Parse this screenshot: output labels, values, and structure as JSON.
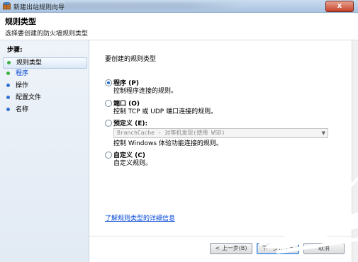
{
  "window": {
    "title": "新建出站规则向导",
    "close_glyph": "x"
  },
  "header": {
    "title": "规则类型",
    "subtitle": "选择要创建的防火墙规则类型"
  },
  "nav": {
    "heading": "步骤:",
    "items": [
      {
        "label": "规则类型",
        "dot_color": "#3cb043",
        "selected": true
      },
      {
        "label": "程序",
        "dot_color": "#3cb043",
        "selected": false
      },
      {
        "label": "操作",
        "dot_color": "#2f6fd0",
        "selected": false
      },
      {
        "label": "配置文件",
        "dot_color": "#2f6fd0",
        "selected": false
      },
      {
        "label": "名称",
        "dot_color": "#2f6fd0",
        "selected": false
      }
    ]
  },
  "main": {
    "question": "要创建的规则类型",
    "options": [
      {
        "label": "程序 (P)",
        "description": "控制程序连接的规则。",
        "checked": true
      },
      {
        "label": "端口 (O)",
        "description": "控制 TCP 或 UDP 端口连接的规则。",
        "checked": false
      },
      {
        "label": "预定义 (E):",
        "description": "控制 Windows 体验功能连接的规则。",
        "checked": false
      },
      {
        "label": "自定义 (C)",
        "description": "自定义规则。",
        "checked": false
      }
    ],
    "predefined_select": {
      "value": "BranchCache - 对等机发现(使用 WSD)"
    },
    "learn_more_link": "了解规则类型的详细信息"
  },
  "footer": {
    "back_label": "< 上一步(B)",
    "next_label": "下一步(N) >",
    "cancel_label": "取消"
  }
}
